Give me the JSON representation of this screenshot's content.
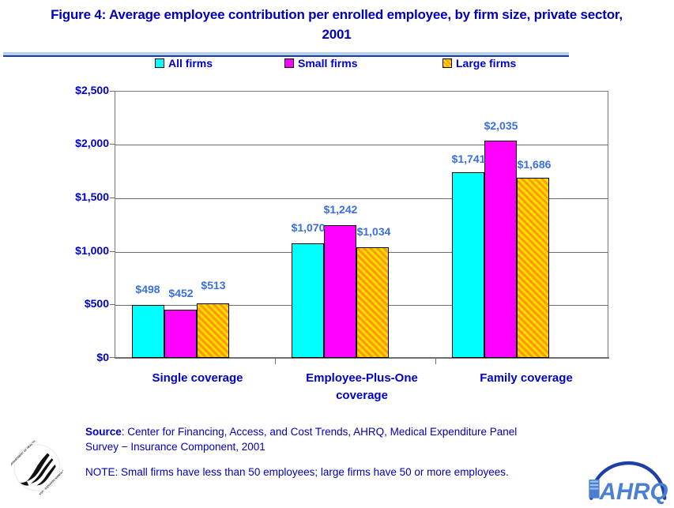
{
  "title": "Figure 4: Average employee contribution per enrolled employee, by firm size, private sector, 2001",
  "legend": {
    "items": [
      {
        "label": "All firms",
        "key": "all",
        "color": "#00ffff"
      },
      {
        "label": "Small firms",
        "key": "small",
        "color": "#ff00ff"
      },
      {
        "label": "Large firms",
        "key": "large",
        "color": "#ff9900"
      }
    ]
  },
  "axis": {
    "y_ticks": [
      "$0",
      "$500",
      "$1,000",
      "$1,500",
      "$2,000",
      "$2,500"
    ],
    "y_min": 0,
    "y_max": 2500,
    "y_step": 500
  },
  "categories": [
    {
      "line1": "Single coverage",
      "line2": ""
    },
    {
      "line1": "Employee-Plus-One",
      "line2": "coverage"
    },
    {
      "line1": "Family coverage",
      "line2": ""
    }
  ],
  "bar_labels": {
    "g0": [
      "$498",
      "$452",
      "$513"
    ],
    "g1": [
      "$1,070",
      "$1,242",
      "$1,034"
    ],
    "g2": [
      "$1,741",
      "$2,035",
      "$1,686"
    ]
  },
  "notes": {
    "source_lead": "Source",
    "source_text": ": Center for Financing, Access, and Cost Trends, AHRQ, Medical Expenditure Panel Survey − Insurance Component, 2001",
    "note_text": "NOTE: Small firms have less than 50 employees; large firms have 50 or more employees."
  },
  "logos": {
    "hhs": "hhs-eagle-seal",
    "ahrq": "AHRQ"
  },
  "chart_data": {
    "type": "bar",
    "title": "Figure 4: Average employee contribution per enrolled employee, by firm size, private sector, 2001",
    "xlabel": "",
    "ylabel": "",
    "ylim": [
      0,
      2500
    ],
    "ytick_step": 500,
    "ytick_labels": [
      "$0",
      "$500",
      "$1,000",
      "$1,500",
      "$2,000",
      "$2,500"
    ],
    "grid": true,
    "legend_position": "top",
    "categories": [
      "Single coverage",
      "Employee-Plus-One coverage",
      "Family coverage"
    ],
    "series": [
      {
        "name": "All firms",
        "color": "#00ffff",
        "values": [
          498,
          1070,
          1741
        ],
        "labels": [
          "$498",
          "$1,070",
          "$1,741"
        ]
      },
      {
        "name": "Small firms",
        "color": "#ff00ff",
        "values": [
          452,
          1242,
          2035
        ],
        "labels": [
          "$452",
          "$1,242",
          "$2,035"
        ]
      },
      {
        "name": "Large firms",
        "color": "#ff9900",
        "values": [
          513,
          1034,
          1686
        ],
        "labels": [
          "$513",
          "$1,034",
          "$1,686"
        ]
      }
    ],
    "source": "Center for Financing, Access, and Cost Trends, AHRQ, Medical Expenditure Panel Survey − Insurance Component, 2001",
    "note": "NOTE: Small firms have less than 50 employees; large firms have 50 or more employees."
  }
}
